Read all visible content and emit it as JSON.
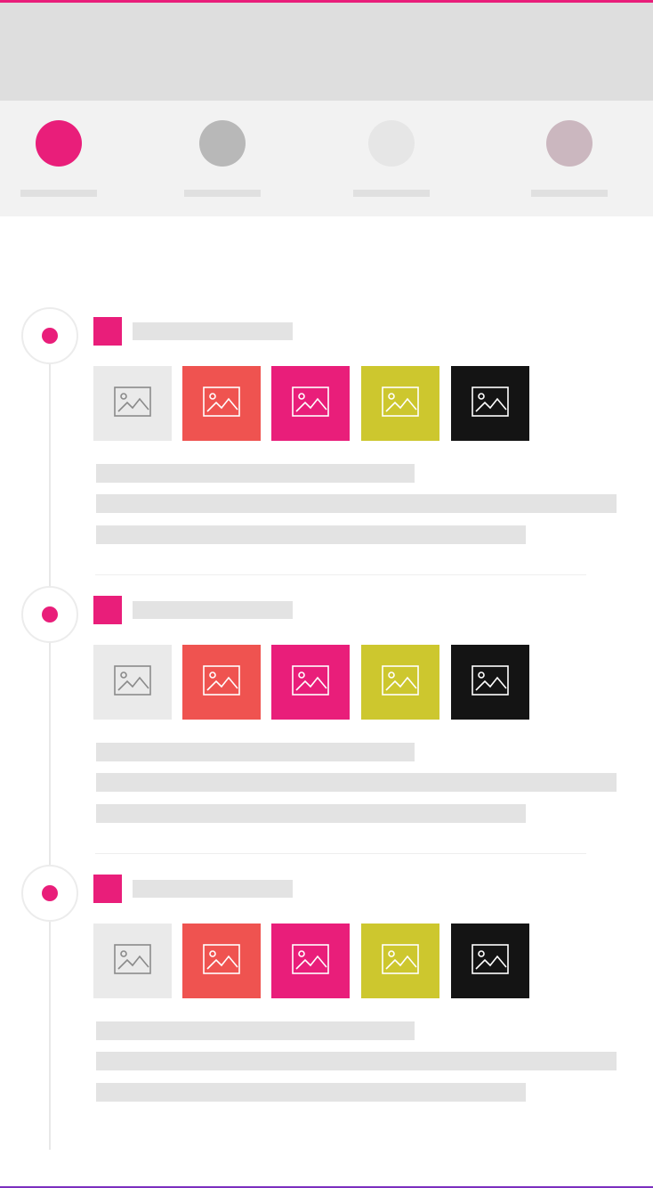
{
  "colors": {
    "accent": "#e91e7a",
    "header_bg": "#dedede",
    "tabs_bg": "#f2f2f2",
    "placeholder": "#e3e3e3"
  },
  "tabs": [
    {
      "name": "tab-1",
      "color": "#e91e7a"
    },
    {
      "name": "tab-2",
      "color": "#b8b8b8"
    },
    {
      "name": "tab-3",
      "color": "#e6e6e6"
    },
    {
      "name": "tab-4",
      "color": "#cbb7bf"
    }
  ],
  "thumbnails": [
    {
      "bg": "#eaeaea",
      "stroke": "#8a8a8a",
      "icon": "image-icon"
    },
    {
      "bg": "#ef5350",
      "stroke": "#ffffff",
      "icon": "image-icon"
    },
    {
      "bg": "#e91e7a",
      "stroke": "#ffffff",
      "icon": "image-icon"
    },
    {
      "bg": "#cdc72e",
      "stroke": "#ffffff",
      "icon": "image-icon"
    },
    {
      "bg": "#141414",
      "stroke": "#ffffff",
      "icon": "image-icon"
    }
  ],
  "entries": [
    {
      "name": "timeline-entry-1"
    },
    {
      "name": "timeline-entry-2"
    },
    {
      "name": "timeline-entry-3"
    }
  ]
}
